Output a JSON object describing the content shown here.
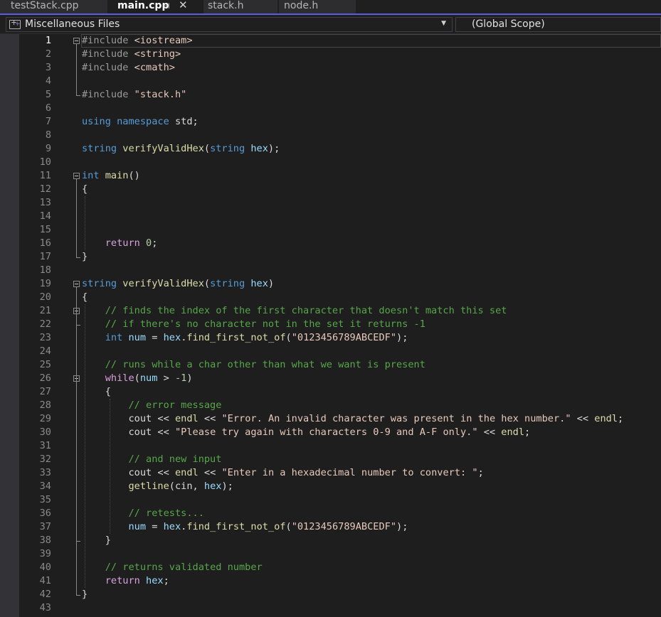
{
  "tabs": [
    {
      "label": "testStack.cpp",
      "active": false
    },
    {
      "label": "main.cpp",
      "active": true
    },
    {
      "label": "stack.h",
      "active": false
    },
    {
      "label": "node.h",
      "active": false
    }
  ],
  "navbar": {
    "project": "Miscellaneous Files",
    "scope": "(Global Scope)"
  },
  "editor": {
    "current_line": 1,
    "lines": [
      {
        "n": 1,
        "fold": true,
        "t": [
          [
            "pp",
            "#include "
          ],
          [
            "inc",
            "<iostream>"
          ]
        ]
      },
      {
        "n": 2,
        "t": [
          [
            "pp",
            "#include "
          ],
          [
            "inc",
            "<string>"
          ]
        ]
      },
      {
        "n": 3,
        "t": [
          [
            "pp",
            "#include "
          ],
          [
            "inc",
            "<cmath>"
          ]
        ]
      },
      {
        "n": 4,
        "t": []
      },
      {
        "n": 5,
        "t": [
          [
            "pp",
            "#include "
          ],
          [
            "str",
            "\"stack.h\""
          ]
        ]
      },
      {
        "n": 6,
        "t": []
      },
      {
        "n": 7,
        "t": [
          [
            "kw",
            "using"
          ],
          [
            "id",
            " "
          ],
          [
            "kw",
            "namespace"
          ],
          [
            "id",
            " std;"
          ]
        ]
      },
      {
        "n": 8,
        "t": []
      },
      {
        "n": 9,
        "t": [
          [
            "kw",
            "string"
          ],
          [
            "id",
            " "
          ],
          [
            "fn",
            "verifyValidHex"
          ],
          [
            "id",
            "("
          ],
          [
            "kw",
            "string"
          ],
          [
            "id",
            " "
          ],
          [
            "var",
            "hex"
          ],
          [
            "id",
            ");"
          ]
        ]
      },
      {
        "n": 10,
        "t": []
      },
      {
        "n": 11,
        "fold": true,
        "t": [
          [
            "kw",
            "int"
          ],
          [
            "id",
            " "
          ],
          [
            "fn",
            "main"
          ],
          [
            "id",
            "()"
          ]
        ]
      },
      {
        "n": 12,
        "t": [
          [
            "id",
            "{"
          ]
        ]
      },
      {
        "n": 13,
        "t": []
      },
      {
        "n": 14,
        "t": []
      },
      {
        "n": 15,
        "t": []
      },
      {
        "n": 16,
        "t": [
          [
            "id",
            "    "
          ],
          [
            "ctl",
            "return"
          ],
          [
            "id",
            " "
          ],
          [
            "num",
            "0"
          ],
          [
            "id",
            ";"
          ]
        ]
      },
      {
        "n": 17,
        "t": [
          [
            "id",
            "}"
          ]
        ]
      },
      {
        "n": 18,
        "t": []
      },
      {
        "n": 19,
        "fold": true,
        "t": [
          [
            "kw",
            "string"
          ],
          [
            "id",
            " "
          ],
          [
            "fn",
            "verifyValidHex"
          ],
          [
            "id",
            "("
          ],
          [
            "kw",
            "string"
          ],
          [
            "id",
            " "
          ],
          [
            "var",
            "hex"
          ],
          [
            "id",
            ")"
          ]
        ]
      },
      {
        "n": 20,
        "t": [
          [
            "id",
            "{"
          ]
        ]
      },
      {
        "n": 21,
        "fold": true,
        "t": [
          [
            "id",
            "    "
          ],
          [
            "cm",
            "// finds the index of the first character that doesn't match this set"
          ]
        ]
      },
      {
        "n": 22,
        "t": [
          [
            "id",
            "    "
          ],
          [
            "cm",
            "// if there's no character not in the set it returns -1"
          ]
        ]
      },
      {
        "n": 23,
        "t": [
          [
            "id",
            "    "
          ],
          [
            "kw",
            "int"
          ],
          [
            "id",
            " "
          ],
          [
            "var",
            "num"
          ],
          [
            "id",
            " = "
          ],
          [
            "var",
            "hex"
          ],
          [
            "id",
            "."
          ],
          [
            "fn",
            "find_first_not_of"
          ],
          [
            "id",
            "("
          ],
          [
            "str",
            "\"0123456789ABCEDF\""
          ],
          [
            "id",
            ");"
          ]
        ]
      },
      {
        "n": 24,
        "t": []
      },
      {
        "n": 25,
        "t": [
          [
            "id",
            "    "
          ],
          [
            "cm",
            "// runs while a char other than what we want is present"
          ]
        ]
      },
      {
        "n": 26,
        "fold": true,
        "t": [
          [
            "id",
            "    "
          ],
          [
            "ctl",
            "while"
          ],
          [
            "id",
            "("
          ],
          [
            "var",
            "num"
          ],
          [
            "id",
            " > "
          ],
          [
            "num",
            "-1"
          ],
          [
            "id",
            ")"
          ]
        ]
      },
      {
        "n": 27,
        "t": [
          [
            "id",
            "    {"
          ]
        ]
      },
      {
        "n": 28,
        "t": [
          [
            "id",
            "        "
          ],
          [
            "cm",
            "// error message"
          ]
        ]
      },
      {
        "n": 29,
        "t": [
          [
            "id",
            "        "
          ],
          [
            "id",
            "cout << "
          ],
          [
            "fn",
            "endl"
          ],
          [
            "id",
            " << "
          ],
          [
            "str",
            "\"Error. An invalid character was present in the hex number.\""
          ],
          [
            "id",
            " << "
          ],
          [
            "fn",
            "endl"
          ],
          [
            "id",
            ";"
          ]
        ]
      },
      {
        "n": 30,
        "t": [
          [
            "id",
            "        "
          ],
          [
            "id",
            "cout << "
          ],
          [
            "str",
            "\"Please try again with characters 0-9 and A-F only.\""
          ],
          [
            "id",
            " << "
          ],
          [
            "fn",
            "endl"
          ],
          [
            "id",
            ";"
          ]
        ]
      },
      {
        "n": 31,
        "t": []
      },
      {
        "n": 32,
        "t": [
          [
            "id",
            "        "
          ],
          [
            "cm",
            "// and new input"
          ]
        ]
      },
      {
        "n": 33,
        "t": [
          [
            "id",
            "        "
          ],
          [
            "id",
            "cout << "
          ],
          [
            "fn",
            "endl"
          ],
          [
            "id",
            " << "
          ],
          [
            "str",
            "\"Enter in a hexadecimal number to convert: \""
          ],
          [
            "id",
            ";"
          ]
        ]
      },
      {
        "n": 34,
        "t": [
          [
            "id",
            "        "
          ],
          [
            "fn",
            "getline"
          ],
          [
            "id",
            "(cin, "
          ],
          [
            "var",
            "hex"
          ],
          [
            "id",
            ");"
          ]
        ]
      },
      {
        "n": 35,
        "t": []
      },
      {
        "n": 36,
        "t": [
          [
            "id",
            "        "
          ],
          [
            "cm",
            "// retests..."
          ]
        ]
      },
      {
        "n": 37,
        "t": [
          [
            "id",
            "        "
          ],
          [
            "var",
            "num"
          ],
          [
            "id",
            " = "
          ],
          [
            "var",
            "hex"
          ],
          [
            "id",
            "."
          ],
          [
            "fn",
            "find_first_not_of"
          ],
          [
            "id",
            "("
          ],
          [
            "str",
            "\"0123456789ABCEDF\""
          ],
          [
            "id",
            ");"
          ]
        ]
      },
      {
        "n": 38,
        "t": [
          [
            "id",
            "    }"
          ]
        ]
      },
      {
        "n": 39,
        "t": []
      },
      {
        "n": 40,
        "t": [
          [
            "id",
            "    "
          ],
          [
            "cm",
            "// returns validated number"
          ]
        ]
      },
      {
        "n": 41,
        "t": [
          [
            "id",
            "    "
          ],
          [
            "ctl",
            "return"
          ],
          [
            "id",
            " "
          ],
          [
            "var",
            "hex"
          ],
          [
            "id",
            ";"
          ]
        ]
      },
      {
        "n": 42,
        "t": [
          [
            "id",
            "}"
          ]
        ]
      },
      {
        "n": 43,
        "t": []
      }
    ]
  }
}
